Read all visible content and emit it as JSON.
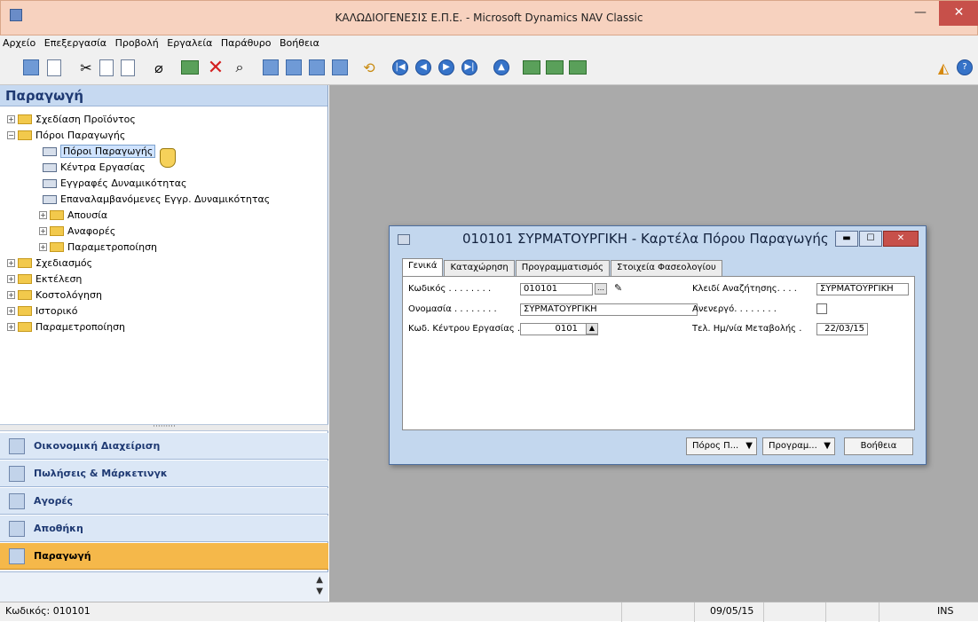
{
  "window": {
    "title": "ΚΑΛΩΔΙΟΓΕΝΕΣΙΣ Ε.Π.Ε. - Microsoft Dynamics NAV Classic"
  },
  "menu": [
    "Αρχείο",
    "Επεξεργασία",
    "Προβολή",
    "Εργαλεία",
    "Παράθυρο",
    "Βοήθεια"
  ],
  "toolbar_icons": [
    "print-icon",
    "print-preview-icon",
    "cut-icon",
    "copy-icon",
    "paste-icon",
    "attach-icon",
    "new-icon",
    "delete-icon",
    "find-icon",
    "form-view-icon",
    "list-view-icon",
    "table-view-icon",
    "field-view-icon",
    "refresh-icon",
    "first-icon",
    "previous-icon",
    "next-icon",
    "last-icon",
    "eject-icon",
    "sort-icon",
    "filter-icon",
    "flowfilter-icon",
    "analysis-icon",
    "help-icon"
  ],
  "nav": {
    "header": "Παραγωγή",
    "tree": [
      {
        "label": "Σχεδίαση Προϊόντος",
        "level": 0,
        "type": "folder",
        "expanded": false
      },
      {
        "label": "Πόροι Παραγωγής",
        "level": 0,
        "type": "folder",
        "expanded": true
      },
      {
        "label": "Πόροι Παραγωγής",
        "level": 1,
        "type": "form",
        "selected": true
      },
      {
        "label": "Κέντρα Εργασίας",
        "level": 1,
        "type": "form"
      },
      {
        "label": "Εγγραφές Δυναμικότητας",
        "level": 1,
        "type": "form"
      },
      {
        "label": "Επαναλαμβανόμενες Εγγρ. Δυναμικότητας",
        "level": 1,
        "type": "form"
      },
      {
        "label": "Απουσία",
        "level": 1,
        "type": "folder",
        "expanded": false
      },
      {
        "label": "Αναφορές",
        "level": 1,
        "type": "folder",
        "expanded": false
      },
      {
        "label": "Παραμετροποίηση",
        "level": 1,
        "type": "folder",
        "expanded": false
      },
      {
        "label": "Σχεδιασμός",
        "level": 0,
        "type": "folder",
        "expanded": false
      },
      {
        "label": "Εκτέλεση",
        "level": 0,
        "type": "folder",
        "expanded": false
      },
      {
        "label": "Κοστολόγηση",
        "level": 0,
        "type": "folder",
        "expanded": false
      },
      {
        "label": "Ιστορικό",
        "level": 0,
        "type": "folder",
        "expanded": false
      },
      {
        "label": "Παραμετροποίηση",
        "level": 0,
        "type": "folder",
        "expanded": false
      }
    ],
    "splitter": "·········",
    "buttons": [
      "Οικονομική Διαχείριση",
      "Πωλήσεις & Μάρκετινγκ",
      "Αγορές",
      "Αποθήκη",
      "Παραγωγή"
    ],
    "active_button": "Παραγωγή"
  },
  "dialog": {
    "title": "010101 ΣΥΡΜΑΤΟΥΡΓΙΚΗ - Καρτέλα Πόρου Παραγωγής",
    "tabs": [
      "Γενικά",
      "Καταχώρηση",
      "Προγραμματισμός",
      "Στοιχεία Φασεολογίου"
    ],
    "active_tab": "Γενικά",
    "fields": {
      "code_label": "Κωδικός . . . . . . . .",
      "code_value": "010101",
      "name_label": "Ονομασία . . . . . . . .",
      "name_value": "ΣΥΡΜΑΤΟΥΡΓΙΚΗ",
      "workcenter_label": "Κωδ. Κέντρου Εργασίας .",
      "workcenter_value": "0101",
      "search_label": "Κλειδί Αναζήτησης. . . .",
      "search_value": "ΣΥΡΜΑΤΟΥΡΓΙΚΗ",
      "blocked_label": "Ανενεργό. . . . . . . .",
      "blocked_value": false,
      "modified_label": "Τελ. Ημ/νία Μεταβολής .",
      "modified_value": "22/03/15"
    },
    "buttons": [
      "Πόρος Π...",
      "Προγραμ...",
      "Βοήθεια"
    ]
  },
  "status": {
    "left": "Κωδικός: 010101",
    "date": "09/05/15",
    "mode": "INS"
  }
}
